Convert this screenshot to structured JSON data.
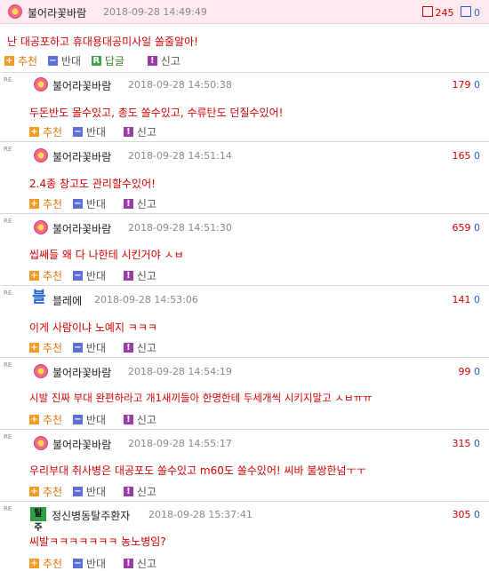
{
  "main_post": {
    "nick": "불어라꽃바람",
    "date": "2018-09-28 14:49:49",
    "up": "245",
    "down": "0",
    "message": "난 대공포하고 휴대용대공미사일 쏠줄알아!",
    "actions": {
      "recommend": "추천",
      "oppose": "반대",
      "reply": "답글",
      "report": "신고"
    }
  },
  "re_label": "RE",
  "reply_actions": {
    "recommend": "추천",
    "oppose": "반대",
    "report": "신고"
  },
  "replies": [
    {
      "nick": "불어라꽃바람",
      "date": "2018-09-28 14:50:38",
      "up": "179",
      "down": "0",
      "message": "두돈반도 몰수있고, 총도 쏠수있고, 수류탄도 던질수있어!",
      "avatar": "flower"
    },
    {
      "nick": "불어라꽃바람",
      "date": "2018-09-28 14:51:14",
      "up": "165",
      "down": "0",
      "message": "2.4종 창고도 관리할수있어!",
      "avatar": "flower"
    },
    {
      "nick": "불어라꽃바람",
      "date": "2018-09-28 14:51:30",
      "up": "659",
      "down": "0",
      "message": "씹쌔들 왜 다 나한테 시킨거야 ㅅㅂ",
      "avatar": "flower"
    },
    {
      "nick": "블레에",
      "date": "2018-09-28 14:53:06",
      "up": "141",
      "down": "0",
      "message": "이게 사람이냐 노예지 ㅋㅋㅋ",
      "avatar": "blue",
      "avatar_text": "블"
    },
    {
      "nick": "불어라꽃바람",
      "date": "2018-09-28 14:54:19",
      "up": "99",
      "down": "0",
      "message": "시발 진짜 부대 완편하라고 개1새끼들아 한명한테 두세개씩 시키지말고 ㅅㅂㅠㅠ",
      "avatar": "flower"
    },
    {
      "nick": "불어라꽃바람",
      "date": "2018-09-28 14:55:17",
      "up": "315",
      "down": "0",
      "message": "우리부대 취사병은 대공포도 쏠수있고 m60도 쏠수있어! 씨바 불쌍한넘ㅜㅜ",
      "avatar": "flower"
    },
    {
      "nick": "정신병동탈주환자",
      "date": "2018-09-28 15:37:41",
      "up": "305",
      "down": "0",
      "message": "씨발ㅋㅋㅋㅋㅋㅋㅋ 농노병임?",
      "avatar": "green",
      "avatar_text": "탈주"
    }
  ]
}
